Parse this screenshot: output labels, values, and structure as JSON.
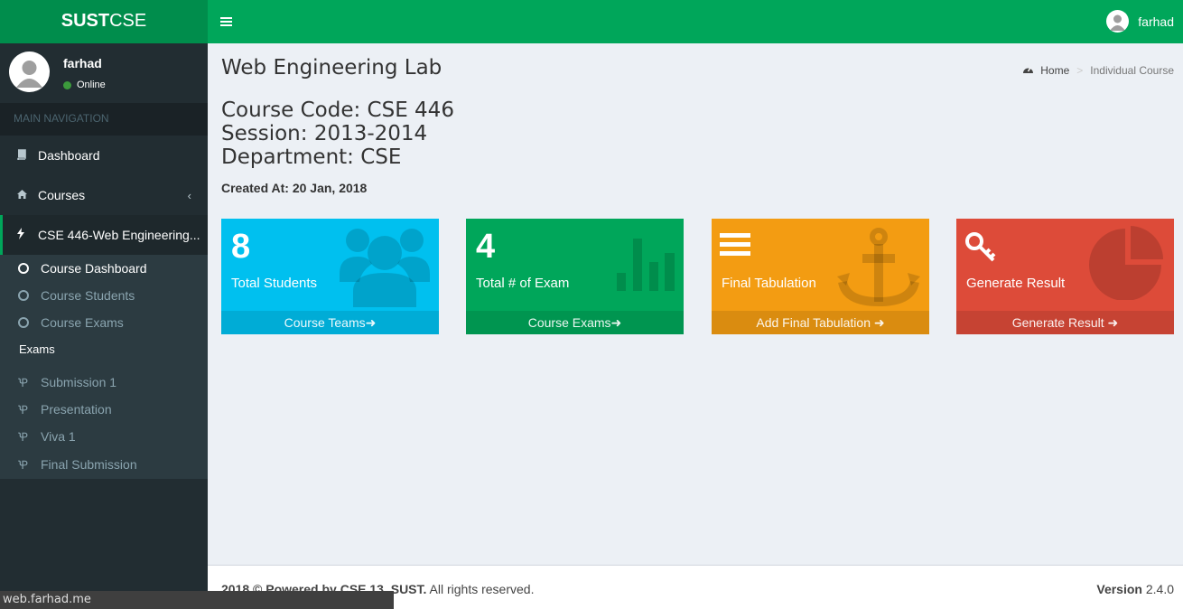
{
  "logo": {
    "bold": "SUST",
    "light": "CSE"
  },
  "user": {
    "name": "farhad",
    "status": "Online"
  },
  "sidebar": {
    "header": "MAIN NAVIGATION",
    "items": [
      {
        "label": "Dashboard",
        "icon": "book-icon"
      },
      {
        "label": "Courses",
        "icon": "home-icon"
      },
      {
        "label": "CSE 446-Web Engineering...",
        "icon": "bolt-icon"
      }
    ],
    "course_items": [
      "Course Dashboard",
      "Course Students",
      "Course Exams"
    ],
    "exams_label": "Exams",
    "exam_items": [
      "Submission 1",
      "Presentation",
      "Viva 1",
      "Final Submission"
    ]
  },
  "topbar": {
    "user_name": "farhad"
  },
  "page": {
    "title": "Web Engineering Lab",
    "breadcrumb": {
      "home": "Home",
      "current": "Individual Course"
    },
    "course_code": "Course Code: CSE 446",
    "session": "Session: 2013-2014",
    "department": "Department: CSE",
    "created_at": "Created At: 20 Jan, 2018"
  },
  "boxes": [
    {
      "value": "8",
      "label": "Total Students",
      "footer": "Course Teams",
      "color": "#00c0ef",
      "icon": "users-icon"
    },
    {
      "value": "4",
      "label": "Total # of Exam",
      "footer": "Course Exams",
      "color": "#00a65a",
      "icon": "bar-chart-icon"
    },
    {
      "value": "",
      "label": "Final Tabulation",
      "footer": "Add Final Tabulation",
      "color": "#f39c12",
      "icon": "anchor-icon"
    },
    {
      "value": "",
      "label": "Generate Result",
      "footer": "Generate Result",
      "color": "#dd4b39",
      "icon": "pie-chart-icon"
    }
  ],
  "footer": {
    "left_bold": "2018 © Powered by CSE 13, SUST.",
    "left_rest": " All rights reserved.",
    "version_label": "Version",
    "version": "2.4.0"
  },
  "statusbar": {
    "url": "web.farhad.me"
  }
}
